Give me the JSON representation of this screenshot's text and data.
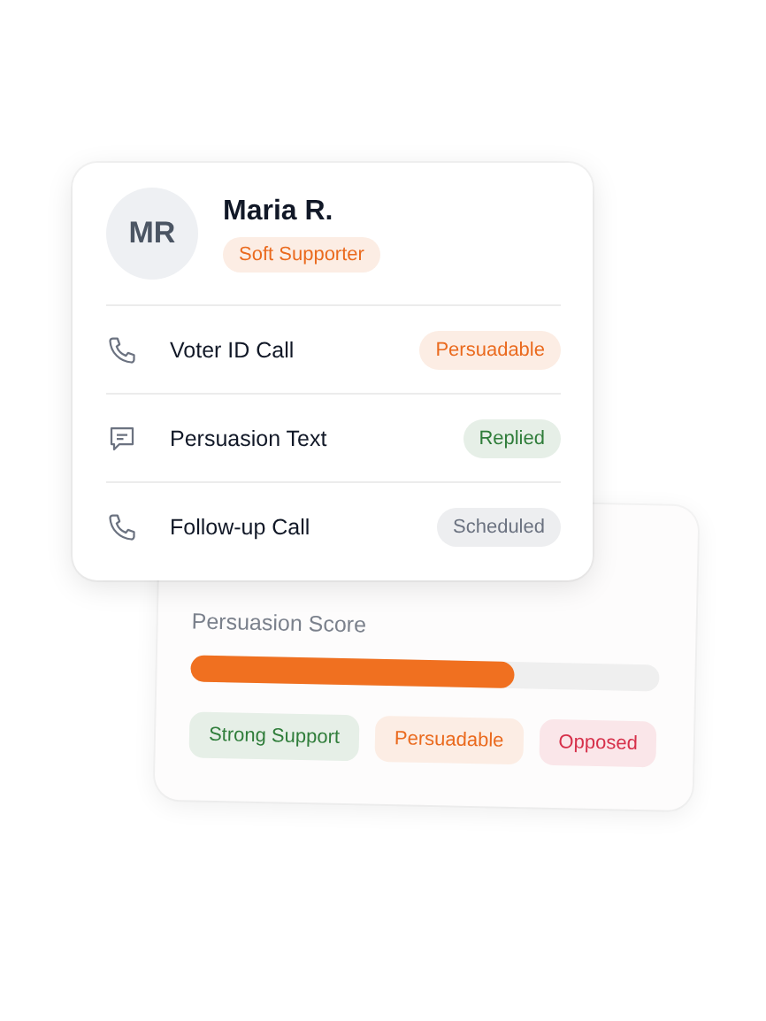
{
  "contact": {
    "initials": "MR",
    "name": "Maria R.",
    "tag": {
      "label": "Soft Supporter",
      "color": "#ea6a1e"
    }
  },
  "activities": [
    {
      "kind": "phone",
      "label": "Voter ID Call",
      "status": {
        "label": "Persuadable",
        "color": "#ea6a1e"
      }
    },
    {
      "kind": "message",
      "label": "Persuasion Text",
      "status": {
        "label": "Replied",
        "color": "#2f7d3a"
      }
    },
    {
      "kind": "phone",
      "label": "Follow-up Call",
      "status": {
        "label": "Scheduled",
        "color": "#6b7280"
      }
    }
  ],
  "score": {
    "title": "Persuasion Score",
    "level": 0.69,
    "legend": [
      {
        "label": "Strong Support",
        "color": "#2f7d3a"
      },
      {
        "label": "Persuadable",
        "color": "#ea6a1e"
      },
      {
        "label": "Opposed",
        "color": "#d6304a"
      }
    ]
  }
}
